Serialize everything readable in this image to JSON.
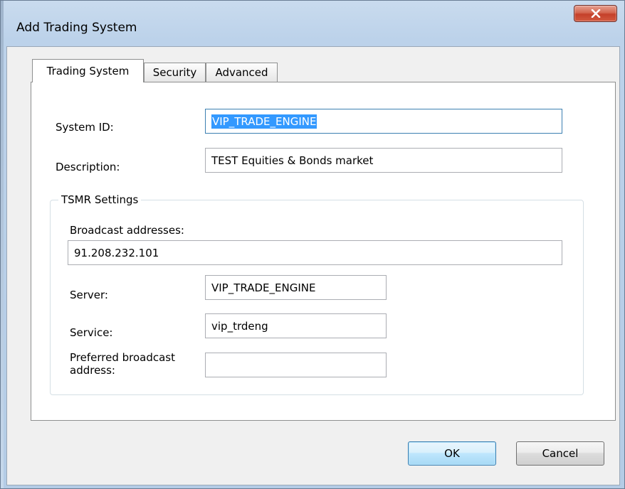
{
  "window": {
    "title": "Add Trading System",
    "close_icon": "close-icon"
  },
  "tabs": [
    {
      "label": "Trading System",
      "active": true
    },
    {
      "label": "Security",
      "active": false
    },
    {
      "label": "Advanced",
      "active": false
    }
  ],
  "form": {
    "system_id": {
      "label": "System ID:",
      "value": "VIP_TRADE_ENGINE",
      "selected": true
    },
    "description": {
      "label": "Description:",
      "value": "TEST Equities & Bonds market"
    }
  },
  "tsmr": {
    "group_label": "TSMR Settings",
    "broadcast_addresses": {
      "label": "Broadcast addresses:",
      "value": "91.208.232.101"
    },
    "server": {
      "label": "Server:",
      "value": "VIP_TRADE_ENGINE"
    },
    "service": {
      "label": "Service:",
      "value": "vip_trdeng"
    },
    "preferred_broadcast": {
      "label_line1": "Preferred broadcast",
      "label_line2": "address:",
      "value": ""
    }
  },
  "buttons": {
    "ok": "OK",
    "cancel": "Cancel"
  },
  "colors": {
    "selection": "#3399ff",
    "focus_border": "#3c7fb1",
    "close_button": "#c4402a"
  }
}
